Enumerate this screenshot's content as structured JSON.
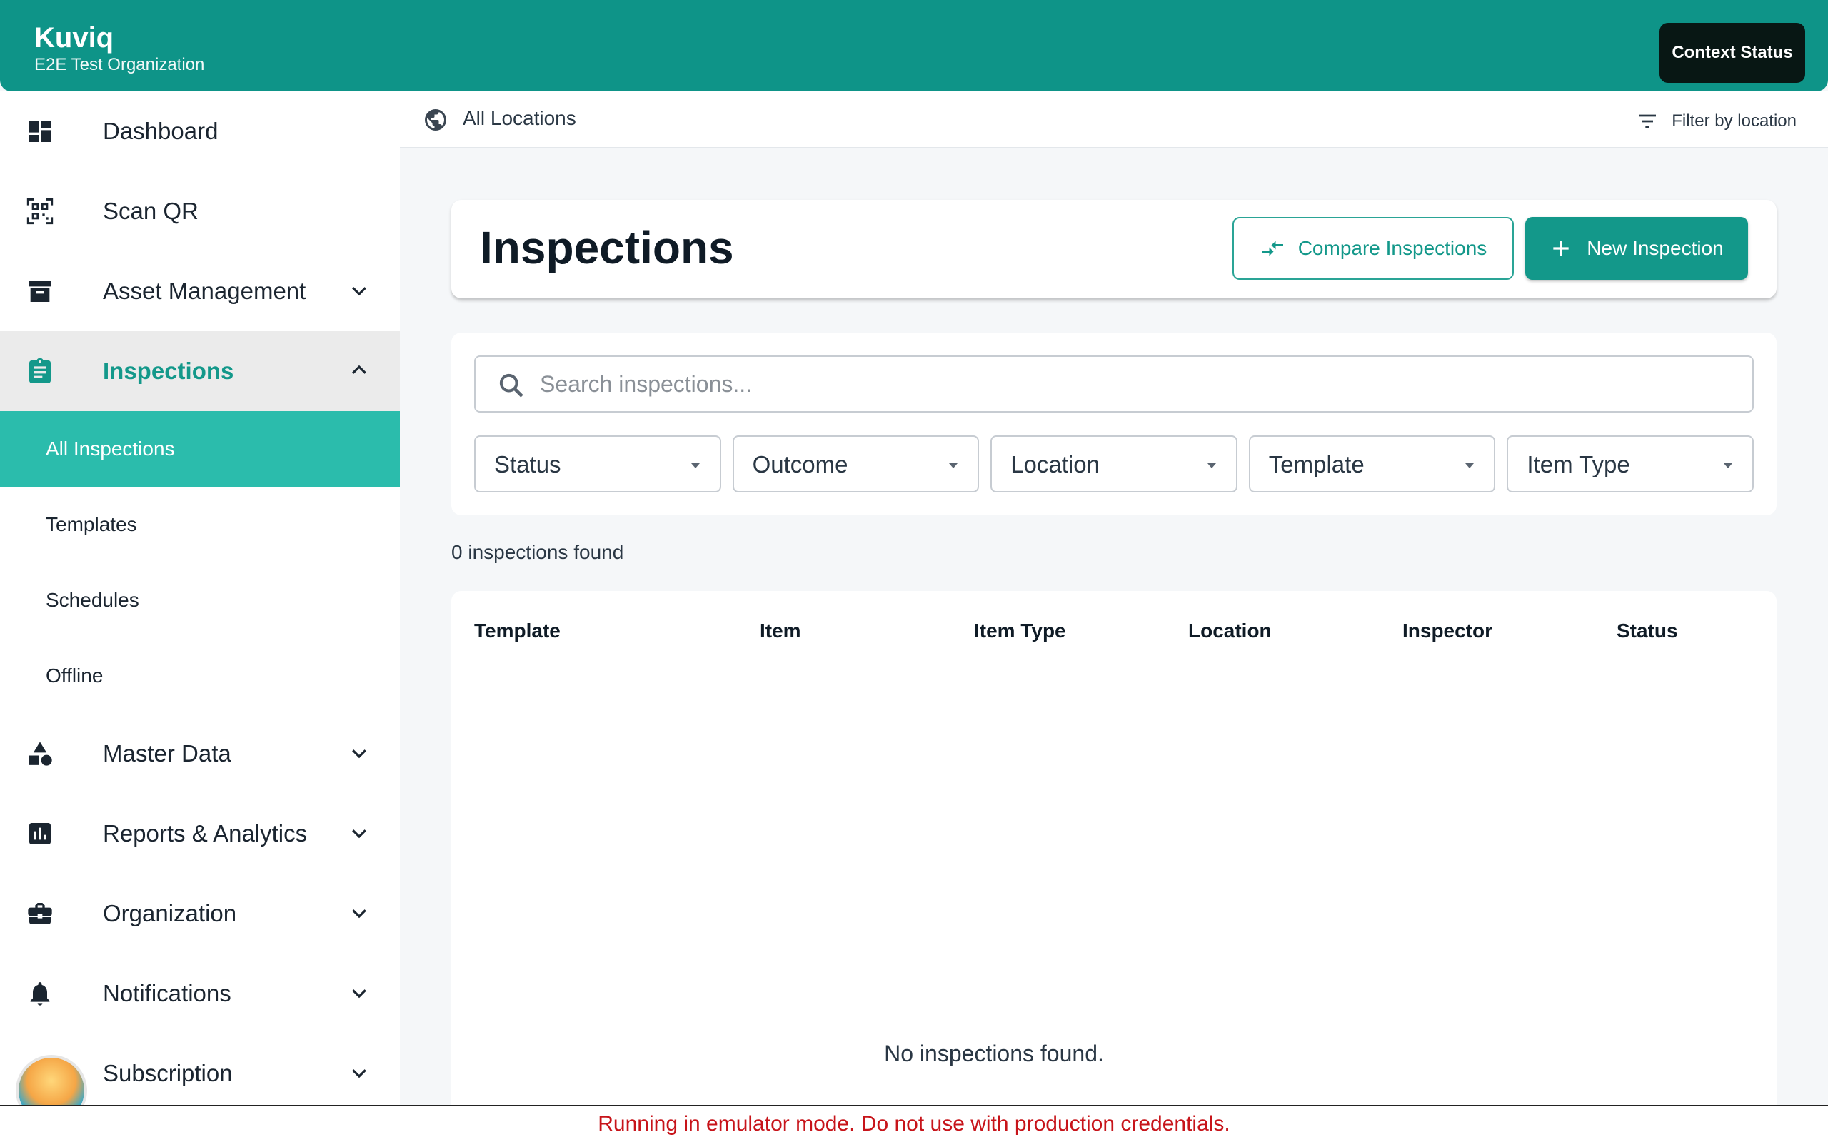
{
  "app": {
    "title": "Kuviq",
    "organization": "E2E Test Organization",
    "context_button": "Context Status"
  },
  "sidebar": {
    "items": [
      {
        "label": "Dashboard",
        "icon": "dashboard-icon"
      },
      {
        "label": "Scan QR",
        "icon": "qr-scan-icon"
      },
      {
        "label": "Asset Management",
        "icon": "archive-icon",
        "expandable": true
      },
      {
        "label": "Inspections",
        "icon": "clipboard-icon",
        "expanded": true,
        "active": true
      },
      {
        "label": "Master Data",
        "icon": "shapes-icon",
        "expandable": true
      },
      {
        "label": "Reports & Analytics",
        "icon": "bar-chart-icon",
        "expandable": true
      },
      {
        "label": "Organization",
        "icon": "briefcase-icon",
        "expandable": true
      },
      {
        "label": "Notifications",
        "icon": "bell-icon",
        "expandable": true
      },
      {
        "label": "Subscription",
        "icon": "avatar",
        "expandable": true
      }
    ],
    "inspections_sub": [
      {
        "label": "All Inspections",
        "active": true
      },
      {
        "label": "Templates"
      },
      {
        "label": "Schedules"
      },
      {
        "label": "Offline"
      }
    ]
  },
  "location_bar": {
    "current": "All Locations",
    "filter_label": "Filter by location"
  },
  "page": {
    "title": "Inspections",
    "compare_button": "Compare Inspections",
    "new_button": "New Inspection",
    "search_placeholder": "Search inspections...",
    "filters": [
      "Status",
      "Outcome",
      "Location",
      "Template",
      "Item Type"
    ],
    "count_text": "0 inspections found",
    "table_headers": [
      "Template",
      "Item",
      "Item Type",
      "Location",
      "Inspector",
      "Status"
    ],
    "empty_text": "No inspections found."
  },
  "banner": {
    "text": "Running in emulator mode. Do not use with production credentials."
  },
  "colors": {
    "primary": "#0e9488",
    "active_sub": "#2bbcac",
    "banner_text": "#c7141a"
  }
}
